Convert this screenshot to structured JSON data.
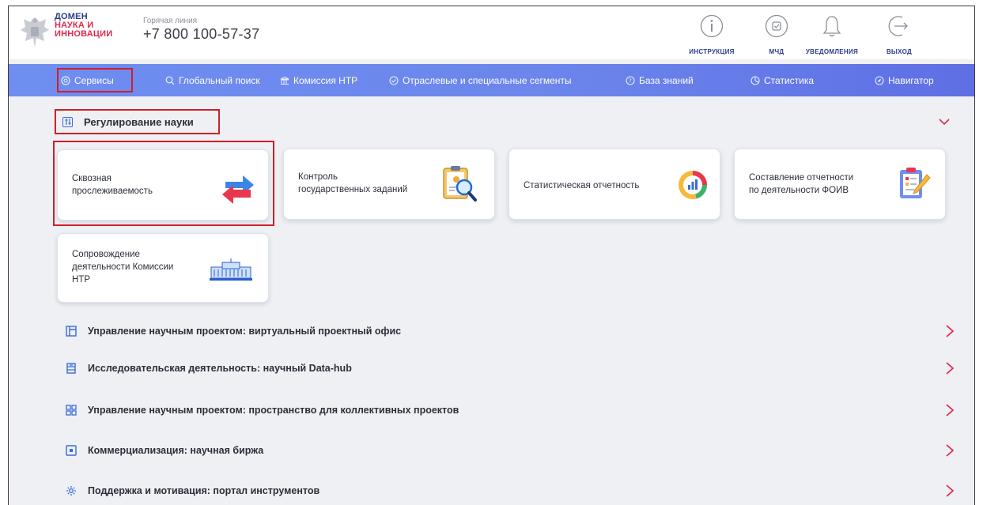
{
  "header": {
    "logo": {
      "line1": "ДОМЕН",
      "line2": "НАУКА И",
      "line3": "ИННОВАЦИИ"
    },
    "hotline_label": "Горячая линия",
    "hotline_phone": "+7 800 100-57-37",
    "actions": [
      {
        "label": "ИНСТРУКЦИЯ",
        "icon": "info-icon"
      },
      {
        "label": "МЧД",
        "icon": "check-square-icon"
      },
      {
        "label": "УВЕДОМЛЕНИЯ",
        "icon": "bell-icon"
      },
      {
        "label": "ВЫХОД",
        "icon": "logout-icon"
      }
    ]
  },
  "nav": {
    "items": [
      {
        "label": "Сервисы",
        "icon": "services-icon",
        "highlighted": true
      },
      {
        "label": "Глобальный поиск",
        "icon": "search-icon"
      },
      {
        "label": "Комиссия НТР",
        "icon": "building-icon"
      },
      {
        "label": "Отраслевые и специальные сегменты",
        "icon": "check-circle-icon"
      },
      {
        "label": "База знаний",
        "icon": "question-icon"
      },
      {
        "label": "Статистика",
        "icon": "stats-icon"
      },
      {
        "label": "Навигатор",
        "icon": "compass-icon"
      }
    ]
  },
  "section": {
    "title": "Регулирование науки",
    "highlighted": true,
    "expanded": true,
    "cards": [
      {
        "label": "Сквозная прослеживаемость",
        "line1": "Сквозная",
        "line2": "прослеживаемость",
        "icon": "arrows-exchange-icon",
        "highlighted": true
      },
      {
        "label": "Контроль государственных заданий",
        "line1": "Контроль",
        "line2": "государственных заданий",
        "icon": "clipboard-search-icon"
      },
      {
        "label": "Статистическая отчетность",
        "line1": "Статистическая отчетность",
        "icon": "chart-ring-icon"
      },
      {
        "label": "Составление отчетности по деятельности ФОИВ",
        "line1": "Составление отчетности",
        "line2": "по деятельности ФОИВ",
        "icon": "clipboard-edit-icon"
      },
      {
        "label": "Сопровождение деятельности Комиссии НТР",
        "line1": "Сопровождение",
        "line2": "деятельности Комиссии",
        "line3": "НТР",
        "icon": "government-building-icon"
      }
    ]
  },
  "rows": [
    {
      "label": "Управление научным проектом: виртуальный проектный офис",
      "icon": "layout-icon"
    },
    {
      "label": "Исследовательская деятельность: научный Data-hub",
      "icon": "database-icon"
    },
    {
      "label": "Управление научным проектом: пространство для коллективных проектов",
      "icon": "grid-icon"
    },
    {
      "label": "Коммерциализация: научная биржа",
      "icon": "exchange-icon"
    },
    {
      "label": "Поддержка и мотивация: портал инструментов",
      "icon": "gear-icon"
    }
  ],
  "colors": {
    "accent": "#3a6bd8",
    "nav_start": "#6f8ef0",
    "nav_end": "#5e6fe4",
    "highlight_box": "#d11f2a",
    "chevron": "#e0284f",
    "brand_blue": "#2a3b8f",
    "brand_red": "#e0284f"
  }
}
